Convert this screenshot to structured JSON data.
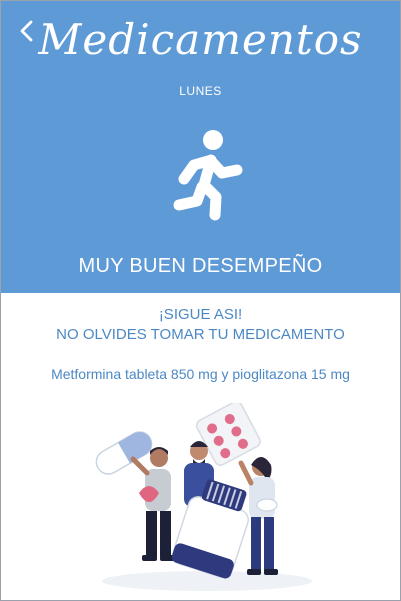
{
  "header": {
    "title": "Medicamentos",
    "day": "LUNES",
    "status": "MUY BUEN DESEMPEÑO",
    "back_icon": "chevron-left-icon",
    "status_icon": "runner-icon"
  },
  "message": {
    "line1": "¡SIGUE ASI!",
    "line2": "NO OLVIDES TOMAR TU MEDICAMENTO"
  },
  "medication": {
    "name": "Metformina tableta 850 mg y pioglitazona 15 mg"
  },
  "colors": {
    "header_bg": "#5e9ad6",
    "accent_text": "#4c88c4"
  }
}
